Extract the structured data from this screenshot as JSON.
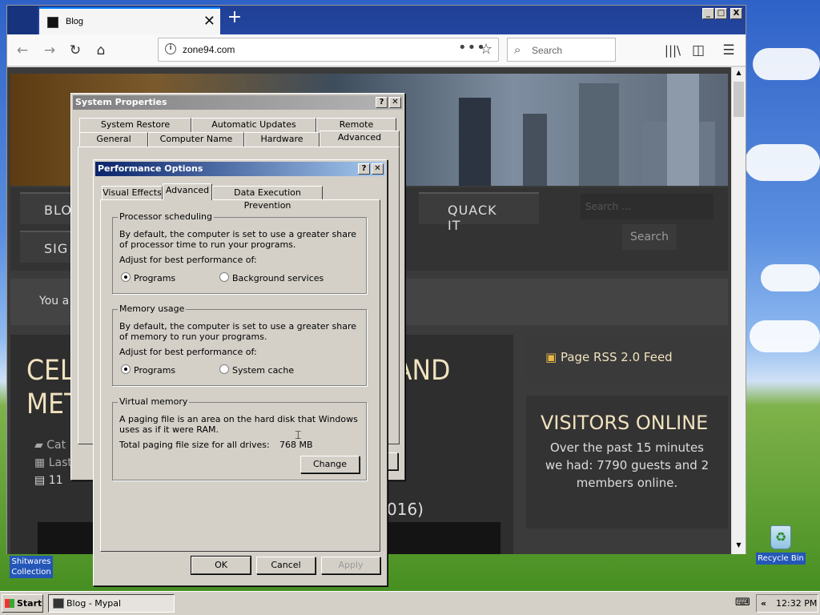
{
  "desktop": {
    "icons": [
      {
        "label_line1": "Shitwares",
        "label_line2": "Collection"
      },
      {
        "label": "Recycle Bin"
      }
    ]
  },
  "browser": {
    "tab_title": "Blog",
    "url": "zone94.com",
    "url_more": "•••",
    "search_placeholder": "Search",
    "window_buttons": {
      "minimize": "_",
      "maximize": "□",
      "close": "X"
    }
  },
  "website": {
    "menu": [
      "BLO",
      "SIG",
      "QUACK IT"
    ],
    "search_placeholder": "Search ...",
    "search_button": "Search",
    "welcome": "You a",
    "article_title_line1": "CELL",
    "article_title_line2": "MET",
    "article_title_suffix": "AND",
    "meta": [
      "Cat",
      "Last",
      "11"
    ],
    "date_fragment": "016)",
    "rss": "Page RSS 2.0 Feed",
    "visitors_title": "VISITORS ONLINE",
    "visitors_text": "Over the past 15 minutes we had: 7790 guests and 2 members online."
  },
  "system_properties": {
    "title": "System Properties",
    "tabs_row1": [
      "System Restore",
      "Automatic Updates",
      "Remote"
    ],
    "tabs_row2": [
      "General",
      "Computer Name",
      "Hardware",
      "Advanced"
    ]
  },
  "performance_options": {
    "title": "Performance Options",
    "tabs": [
      "Visual Effects",
      "Advanced",
      "Data Execution Prevention"
    ],
    "processor": {
      "caption": "Processor scheduling",
      "desc": "By default, the computer is set to use a greater share of processor time to run your programs.",
      "adjust": "Adjust for best performance of:",
      "opt1": "Programs",
      "opt2": "Background services"
    },
    "memory": {
      "caption": "Memory usage",
      "desc": "By default, the computer is set to use a greater share of memory to run your programs.",
      "adjust": "Adjust for best performance of:",
      "opt1": "Programs",
      "opt2": "System cache"
    },
    "virtual": {
      "caption": "Virtual memory",
      "desc": "A paging file is an area on the hard disk that Windows uses as if it were RAM.",
      "total_label": "Total paging file size for all drives:",
      "total_value": "768 MB",
      "change": "Change"
    },
    "buttons": {
      "ok": "OK",
      "cancel": "Cancel",
      "apply": "Apply"
    }
  },
  "taskbar": {
    "start": "Start",
    "item": "Blog - Mypal",
    "clock": "12:32 PM",
    "chev": "«"
  },
  "colors": {
    "xp_title_active": "#0a246a",
    "xp_title_inactive": "#808080",
    "dialog_face": "#d4d0c8"
  }
}
